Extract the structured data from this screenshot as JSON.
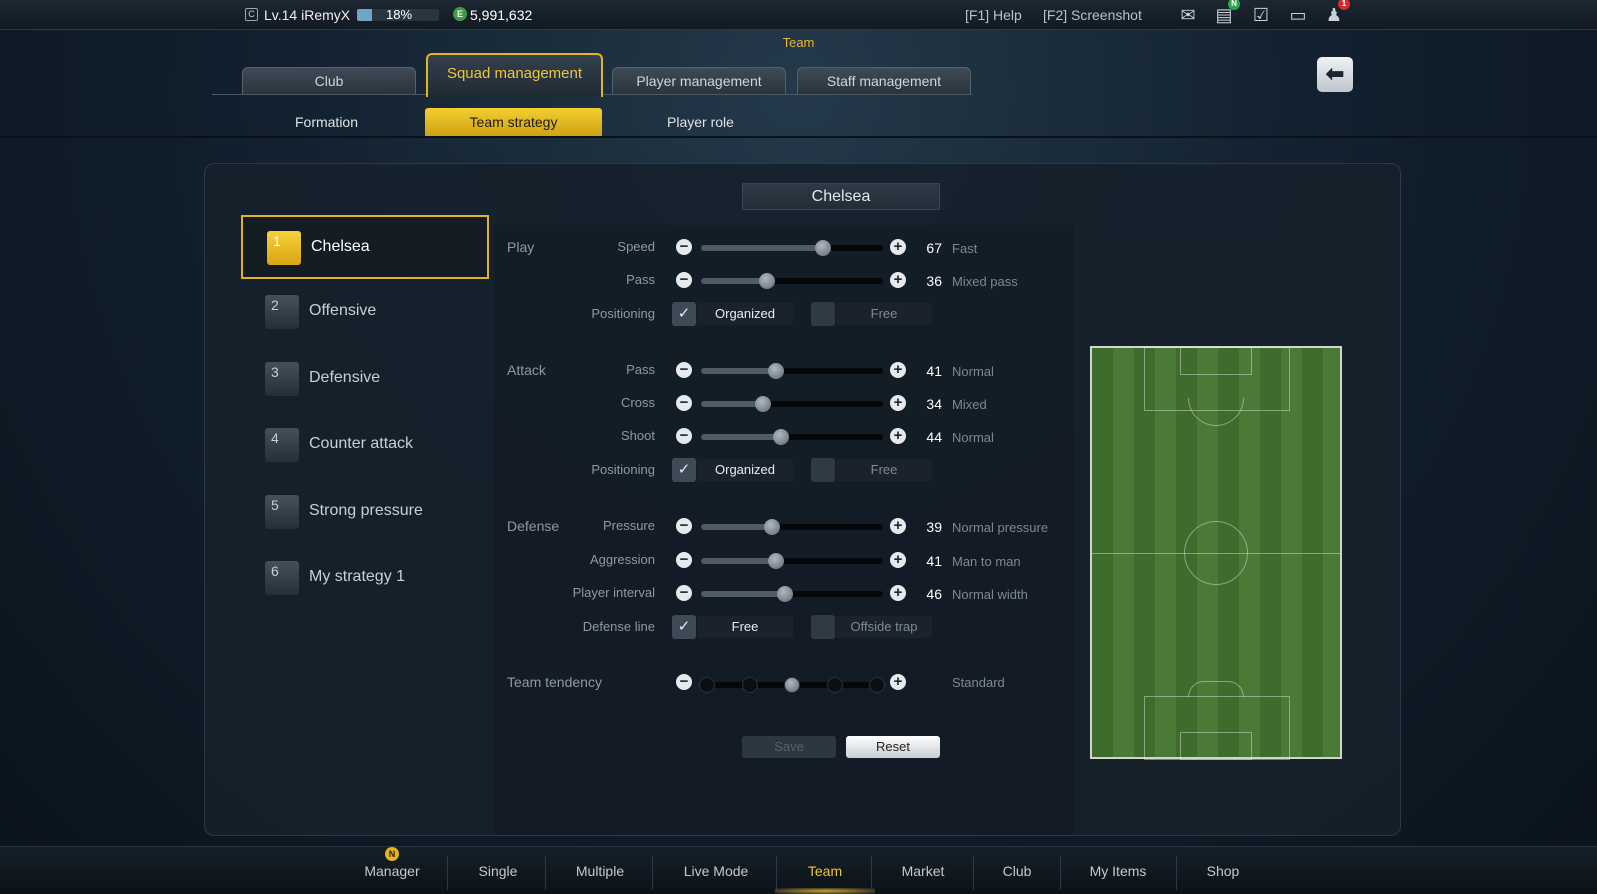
{
  "topbar": {
    "level_icon": "C",
    "level_text": "Lv.14 iRemyX",
    "xp_percent": 0.18,
    "xp_label": "18%",
    "coin_icon": "E",
    "money": "5,991,632",
    "help": "[F1] Help",
    "screenshot": "[F2] Screenshot",
    "icons": [
      "mail-icon",
      "news-icon",
      "checklist-icon",
      "chat-icon",
      "notification-icon"
    ],
    "news_badge": "N",
    "notification_badge": "1"
  },
  "section_title": "Team",
  "tabs": [
    {
      "label": "Club"
    },
    {
      "label": "Squad management"
    },
    {
      "label": "Player management"
    },
    {
      "label": "Staff management"
    }
  ],
  "subtabs": [
    {
      "label": "Formation"
    },
    {
      "label": "Team strategy"
    },
    {
      "label": "Player role"
    }
  ],
  "strategies": [
    {
      "num": "1",
      "label": "Chelsea"
    },
    {
      "num": "2",
      "label": "Offensive"
    },
    {
      "num": "3",
      "label": "Defensive"
    },
    {
      "num": "4",
      "label": "Counter attack"
    },
    {
      "num": "5",
      "label": "Strong pressure"
    },
    {
      "num": "6",
      "label": "My strategy 1"
    }
  ],
  "strategy_title": "Chelsea",
  "groups": {
    "play": "Play",
    "attack": "Attack",
    "defense": "Defense",
    "team_tendency": "Team tendency"
  },
  "play": {
    "speed": {
      "label": "Speed",
      "value": 67,
      "value_text": "67",
      "desc": "Fast"
    },
    "pass": {
      "label": "Pass",
      "value": 36,
      "value_text": "36",
      "desc": "Mixed pass"
    },
    "positioning": {
      "label": "Positioning",
      "opt1": "Organized",
      "opt2": "Free"
    }
  },
  "attack": {
    "pass": {
      "label": "Pass",
      "value": 41,
      "value_text": "41",
      "desc": "Normal"
    },
    "cross": {
      "label": "Cross",
      "value": 34,
      "value_text": "34",
      "desc": "Mixed"
    },
    "shoot": {
      "label": "Shoot",
      "value": 44,
      "value_text": "44",
      "desc": "Normal"
    },
    "positioning": {
      "label": "Positioning",
      "opt1": "Organized",
      "opt2": "Free"
    }
  },
  "defense": {
    "pressure": {
      "label": "Pressure",
      "value": 39,
      "value_text": "39",
      "desc": "Normal pressure"
    },
    "aggression": {
      "label": "Aggression",
      "value": 41,
      "value_text": "41",
      "desc": "Man to man"
    },
    "player_interval": {
      "label": "Player interval",
      "value": 46,
      "value_text": "46",
      "desc": "Normal width"
    },
    "defense_line": {
      "label": "Defense line",
      "opt1": "Free",
      "opt2": "Offside trap"
    }
  },
  "team_tendency": {
    "desc": "Standard",
    "steps": 5,
    "selected": 3
  },
  "buttons": {
    "save": "Save",
    "reset": "Reset"
  },
  "bottom_nav": [
    {
      "label": "Manager"
    },
    {
      "label": "Single"
    },
    {
      "label": "Multiple"
    },
    {
      "label": "Live Mode"
    },
    {
      "label": "Team"
    },
    {
      "label": "Market"
    },
    {
      "label": "Club"
    },
    {
      "label": "My Items"
    },
    {
      "label": "Shop"
    }
  ],
  "bottom_badge": "N",
  "colors": {
    "accent": "#e4b422",
    "pitch": "#4b7a36"
  }
}
